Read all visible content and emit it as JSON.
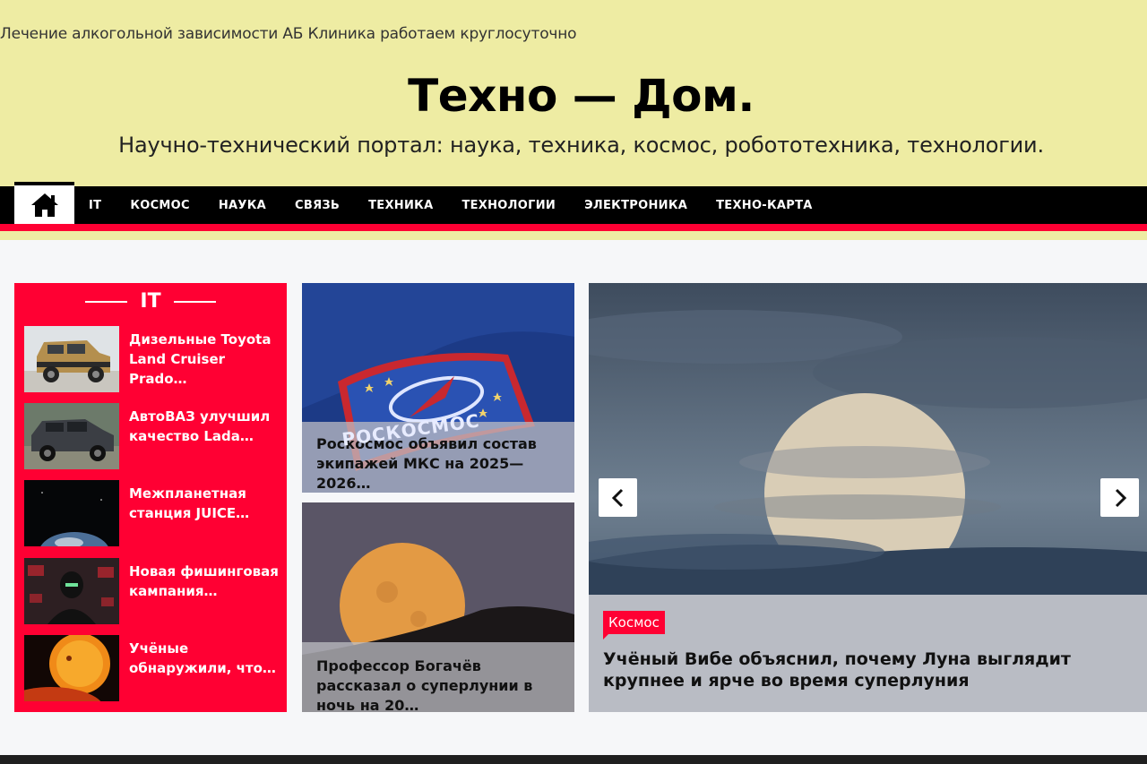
{
  "header": {
    "top_text": "Лечение алкогольной зависимости АБ Клиника работаем круглосуточно",
    "site_title": "Техно — Дом.",
    "tagline": "Научно-технический портал: наука, техника, космос, робототехника, технологии."
  },
  "nav": {
    "home_icon": "home-icon",
    "items": [
      "IT",
      "Космос",
      "Наука",
      "Связь",
      "Техника",
      "Технологии",
      "Электроника",
      "Техно-карта"
    ]
  },
  "left_panel": {
    "title": "IT",
    "items": [
      {
        "title": "Дизельные Toyota Land Cruiser Prado…"
      },
      {
        "title": "АвтоВАЗ улучшил качество Lada…"
      },
      {
        "title": "Межпланетная станция JUICE…"
      },
      {
        "title": "Новая фишинговая кампания…"
      },
      {
        "title": "Учёные обнаружили, что…"
      }
    ]
  },
  "cards": [
    {
      "title": "Роскосмос объявил состав экипажей МКС на 2025—2026…",
      "patch_text": "РОСКОСМОС"
    },
    {
      "title": "Профессор Богачёв рассказал о суперлунии в ночь на 20…"
    }
  ],
  "slider": {
    "category": "Космос",
    "title": "Учёный Вибе объяснил, почему Луна выглядит крупнее и ярче во время суперлуния",
    "prev_icon": "chevron-left-icon",
    "next_icon": "chevron-right-icon"
  },
  "colors": {
    "header_bg": "#eeeca3",
    "accent_red": "#ff0033",
    "nav_bg": "#000000"
  }
}
